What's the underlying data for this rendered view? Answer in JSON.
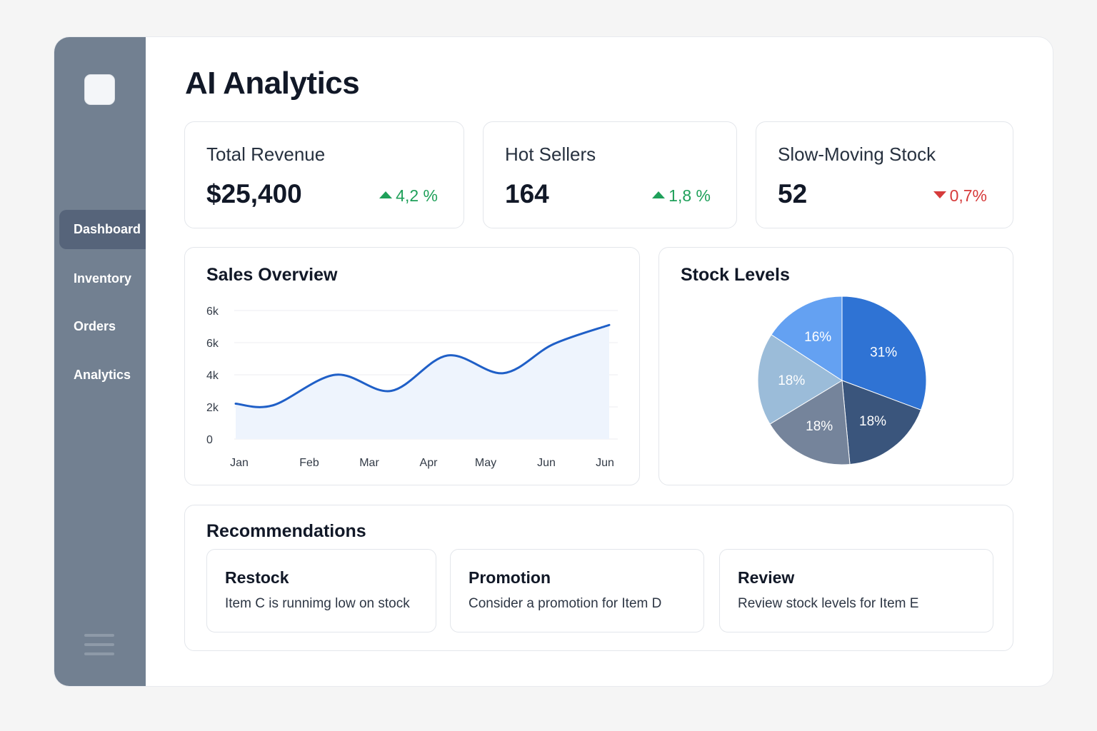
{
  "app": {
    "title": "AI Analytics"
  },
  "sidebar": {
    "items": [
      {
        "label": "Dashboard",
        "active": true
      },
      {
        "label": "Inventory",
        "active": false
      },
      {
        "label": "Orders",
        "active": false
      },
      {
        "label": "Analytics",
        "active": false
      }
    ]
  },
  "kpis": [
    {
      "label": "Total Revenue",
      "value": "$25,400",
      "change": "4,2 %",
      "direction": "up"
    },
    {
      "label": "Hot Sellers",
      "value": "164",
      "change": "1,8 %",
      "direction": "up"
    },
    {
      "label": "Slow-Moving Stock",
      "value": "52",
      "change": "0,7%",
      "direction": "down"
    }
  ],
  "sales": {
    "title": "Sales Overview"
  },
  "stock": {
    "title": "Stock Levels"
  },
  "recommendations": {
    "title": "Recommendations",
    "items": [
      {
        "title": "Restock",
        "text": "Item C is runnimg low on stock"
      },
      {
        "title": "Promotion",
        "text": "Consider a promotion for Item D"
      },
      {
        "title": "Review",
        "text": "Review stock levels for Item E"
      }
    ]
  },
  "colors": {
    "sidebar": "#728091",
    "accent": "#1f5fc7",
    "up": "#1fa05a",
    "down": "#d63b3b"
  },
  "chart_data": [
    {
      "type": "area",
      "title": "Sales Overview",
      "categories": [
        "Jan",
        "Feb",
        "Mar",
        "Apr",
        "May",
        "Jun",
        "Jun"
      ],
      "y_tick_labels": [
        "0",
        "2k",
        "4k",
        "6k",
        "6k"
      ],
      "x": [
        0,
        0.6,
        1.6,
        2.5,
        3.4,
        4.3,
        5.1,
        6.0
      ],
      "y": [
        2.2,
        2.1,
        4.0,
        3.0,
        5.2,
        4.1,
        5.9,
        7.1
      ],
      "ylim": [
        0,
        8
      ],
      "grid": true,
      "color": "#1f5fc7"
    },
    {
      "type": "pie",
      "title": "Stock Levels",
      "labels": [
        "31%",
        "18%",
        "18%",
        "18%",
        "16%"
      ],
      "values": [
        31,
        18,
        18,
        18,
        16
      ],
      "colors": [
        "#2f73d4",
        "#3a557c",
        "#75849b",
        "#9bbcd9",
        "#64a1f2"
      ]
    }
  ]
}
